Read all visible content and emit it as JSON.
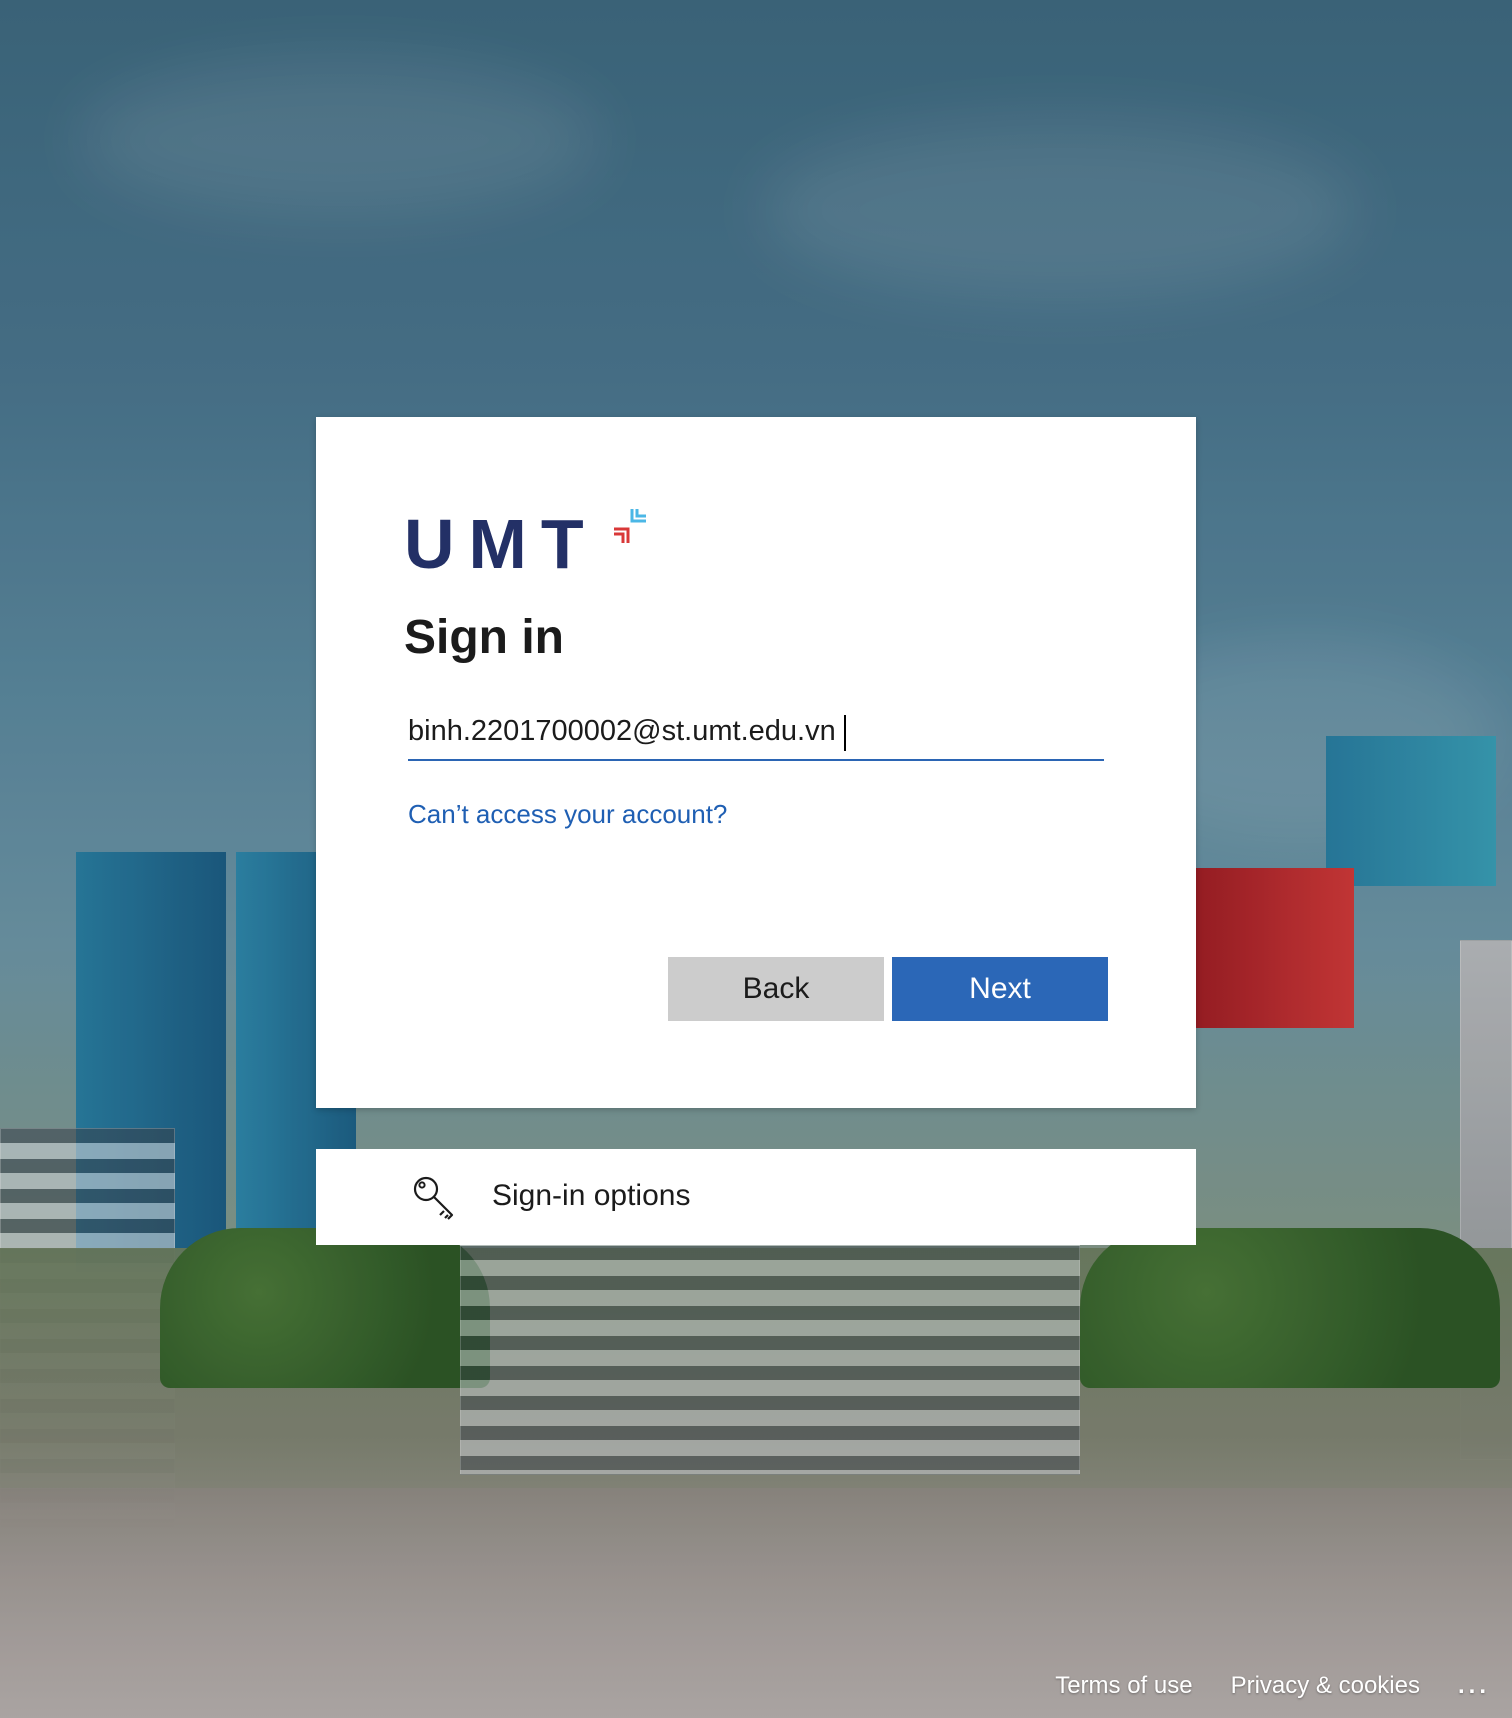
{
  "brand": {
    "logo_text": "UMT",
    "navy": "#233066",
    "accent_red": "#d93838",
    "accent_blue": "#4bb7e6"
  },
  "signin": {
    "title": "Sign in",
    "email_value": "binh.2201700002@st.umt.edu.vn",
    "cant_access_link": "Can’t access your account?",
    "back_label": "Back",
    "next_label": "Next",
    "primary_color": "#2b67b7"
  },
  "options": {
    "label": "Sign-in options",
    "icon": "key-icon"
  },
  "footer": {
    "terms": "Terms of use",
    "privacy": "Privacy & cookies",
    "more": "..."
  }
}
